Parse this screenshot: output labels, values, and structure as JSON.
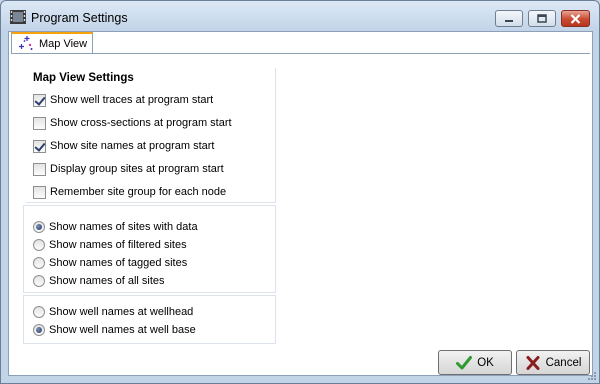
{
  "window": {
    "title": "Program Settings",
    "app_icon": "film-icon",
    "controls": [
      "minimize-icon",
      "maximize-icon",
      "close-icon"
    ]
  },
  "tabs": [
    {
      "label": "Map View",
      "icon": "sparkle-icon",
      "active": true
    }
  ],
  "map_view": {
    "section_title": "Map View Settings",
    "checkboxes": [
      {
        "label": "Show well traces at program start",
        "checked": true
      },
      {
        "label": "Show cross-sections at program start",
        "checked": false
      },
      {
        "label": "Show site names at program start",
        "checked": true
      },
      {
        "label": "Display group sites at program start",
        "checked": false
      },
      {
        "label": "Remember site group for each node",
        "checked": false
      }
    ],
    "site_names_radio": [
      {
        "label": "Show names of sites with data",
        "selected": true
      },
      {
        "label": "Show names of filtered sites",
        "selected": false
      },
      {
        "label": "Show names of tagged sites",
        "selected": false
      },
      {
        "label": "Show names of all sites",
        "selected": false
      }
    ],
    "well_names_radio": [
      {
        "label": "Show well names at wellhead",
        "selected": false
      },
      {
        "label": "Show well names at well base",
        "selected": true
      }
    ]
  },
  "footer": {
    "ok_label": "OK",
    "ok_icon": "checkmark-icon",
    "cancel_label": "Cancel",
    "cancel_icon": "x-icon"
  },
  "colors": {
    "title_bg": "#c2d4e8",
    "close_button": "#c74a32",
    "tab_accent": "#f6a20b",
    "ok_icon": "#2f9a2f",
    "cancel_icon": "#8a1e1e"
  }
}
